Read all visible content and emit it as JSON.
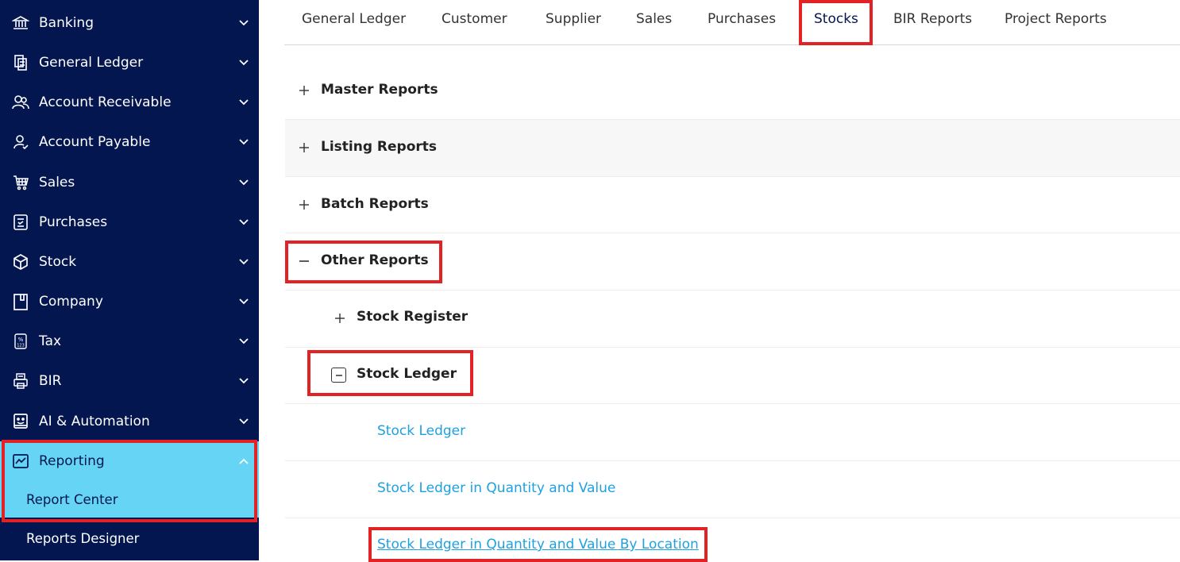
{
  "sidebar": {
    "items": [
      {
        "label": "Banking",
        "icon": "bank-icon"
      },
      {
        "label": "General Ledger",
        "icon": "ledger-icon"
      },
      {
        "label": "Account Receivable",
        "icon": "users-icon"
      },
      {
        "label": "Account Payable",
        "icon": "user-check-icon"
      },
      {
        "label": "Sales",
        "icon": "cart-icon"
      },
      {
        "label": "Purchases",
        "icon": "receipt-icon"
      },
      {
        "label": "Stock",
        "icon": "box-icon"
      },
      {
        "label": "Company",
        "icon": "building-icon"
      },
      {
        "label": "Tax",
        "icon": "percent-icon"
      },
      {
        "label": "BIR",
        "icon": "printer-icon"
      },
      {
        "label": "AI & Automation",
        "icon": "robot-icon"
      },
      {
        "label": "Reporting",
        "icon": "chart-line-icon"
      }
    ],
    "sub_items": [
      {
        "label": "Report Center"
      },
      {
        "label": "Reports Designer"
      }
    ]
  },
  "tabs": [
    {
      "label": "General Ledger"
    },
    {
      "label": "Customer"
    },
    {
      "label": "Supplier"
    },
    {
      "label": "Sales"
    },
    {
      "label": "Purchases"
    },
    {
      "label": "Stocks"
    },
    {
      "label": "BIR Reports"
    },
    {
      "label": "Project Reports"
    }
  ],
  "reports": {
    "master": "Master Reports",
    "listing": "Listing Reports",
    "batch": "Batch Reports",
    "other": "Other Reports",
    "stock_register": "Stock Register",
    "stock_ledger": "Stock Ledger",
    "links": [
      "Stock Ledger",
      "Stock Ledger in Quantity and Value",
      "Stock Ledger in Quantity and Value By Location"
    ]
  },
  "colors": {
    "sidebar_bg": "#03164f",
    "active_bg": "#66d5f5",
    "highlight": "#e32226",
    "link": "#1da1e2"
  }
}
